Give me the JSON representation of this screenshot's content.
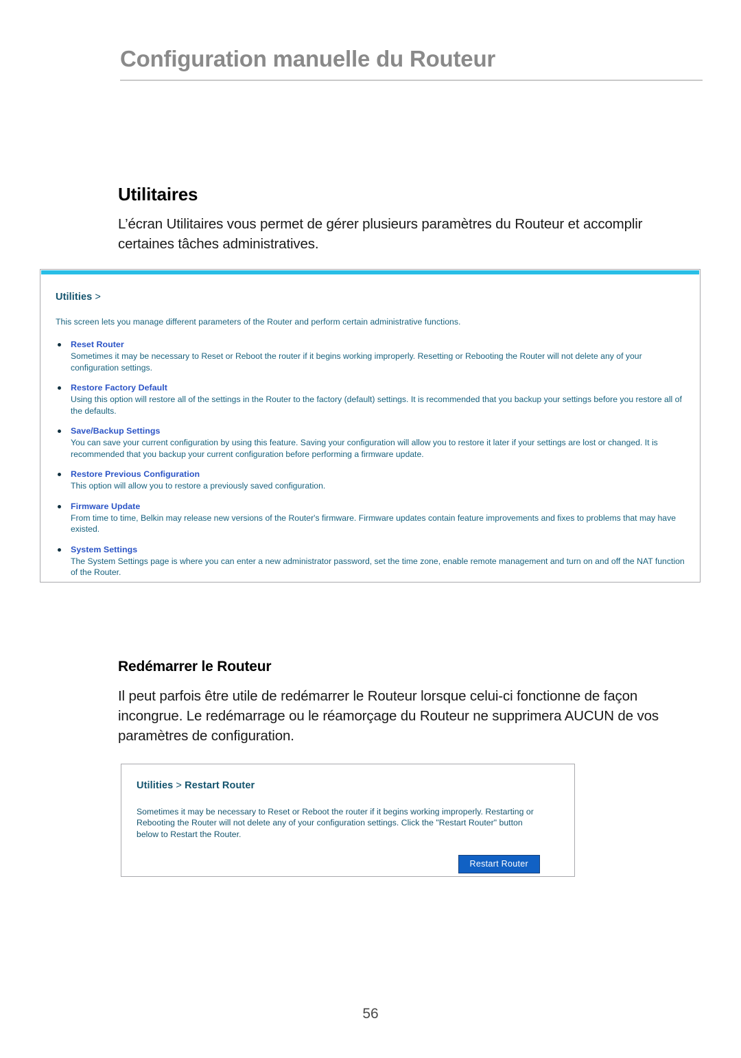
{
  "header": {
    "title": "Configuration manuelle du Routeur"
  },
  "sections": {
    "utilitaires": {
      "title": "Utilitaires",
      "paragraph": "L’écran Utilitaires vous permet de gérer plusieurs paramètres du Routeur et accomplir certaines tâches administratives."
    },
    "restart": {
      "title": "Redémarrer le Routeur",
      "paragraph": "Il peut parfois être utile de redémarrer le Routeur lorsque celui-ci fonctionne de façon incongrue. Le redémarrage ou le réamorçage du Routeur ne supprimera AUCUN de vos paramètres de configuration."
    }
  },
  "screenshot_utilities": {
    "breadcrumb": "Utilities",
    "breadcrumb_separator": ">",
    "intro": "This screen lets you manage different parameters of the Router and perform certain administrative functions.",
    "items": [
      {
        "heading": "Reset Router",
        "description": "Sometimes it may be necessary to Reset or Reboot the router if it begins working improperly. Resetting or Rebooting the Router will not delete any of your configuration settings."
      },
      {
        "heading": "Restore Factory Default",
        "description": "Using this option will restore all of the settings in the Router to the factory (default) settings. It is recommended that you backup your settings before you restore all of the defaults."
      },
      {
        "heading": "Save/Backup Settings",
        "description": "You can save your current configuration by using this feature. Saving your configuration will allow you to restore it later if your settings are lost or changed. It is recommended that you backup your current configuration before performing a firmware update."
      },
      {
        "heading": "Restore Previous Configuration",
        "description": "This option will allow you to restore a previously saved configuration."
      },
      {
        "heading": "Firmware Update",
        "description": "From time to time, Belkin may release new versions of the Router's firmware. Firmware updates contain feature improvements and fixes to problems that may have existed."
      },
      {
        "heading": "System Settings",
        "description": "The System Settings page is where you can enter a new administrator password, set the time zone, enable remote management and turn on and off the NAT function of the Router."
      }
    ]
  },
  "screenshot_restart": {
    "breadcrumb": "Utilities",
    "breadcrumb_separator": ">",
    "breadcrumb_current": "Restart Router",
    "intro": "Sometimes it may be necessary to Reset or Reboot the router if it begins working improperly. Restarting or Rebooting the Router will not delete any of your configuration settings. Click the \"Restart Router\" button below to Restart the Router.",
    "button_label": "Restart Router"
  },
  "footer": {
    "page_number": "56"
  },
  "colors": {
    "header_gray": "#8a8a8a",
    "panel_border": "#a9a9ad",
    "accent_cyan": "#29bee6",
    "crumb_navy": "#14546e",
    "feature_blue": "#2b54c6",
    "body_teal": "#17617d",
    "button_blue": "#1161c4"
  }
}
